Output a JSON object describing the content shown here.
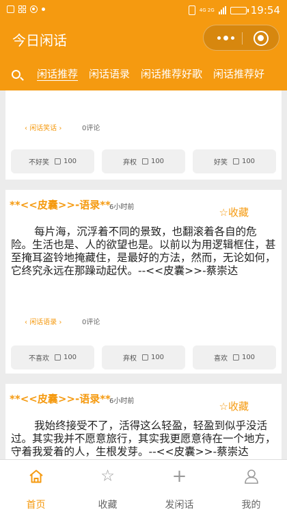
{
  "status_bar": {
    "network": "4G 2G",
    "time": "19:54"
  },
  "header": {
    "title": "今日闲话"
  },
  "tabs": [
    {
      "label": "闲话推荐",
      "active": true
    },
    {
      "label": "闲话语录",
      "active": false
    },
    {
      "label": "闲话推荐好歌",
      "active": false
    },
    {
      "label": "闲话推荐好",
      "active": false
    }
  ],
  "cards": [
    {
      "tag": "闲话笑话",
      "comments": "0评论",
      "buttons": [
        "不好笑 ",
        "弃权 ",
        "好笑 "
      ],
      "counts": [
        "100",
        "100",
        "100"
      ]
    },
    {
      "author": "**<<皮囊>>-语录**",
      "time": "6小时前",
      "fav": "☆收藏",
      "text": "每片海，沉浮着不同的景致，也翻滚着各自的危险。生活也是、人的欲望也是。以前以为用逻辑框住，甚至掩耳盗铃地掩藏住，是最好的方法，然而，无论如何，它终究永远在那躁动起伏。--<<皮囊>>-蔡崇达",
      "tag": "闲话语录",
      "comments": "0评论",
      "buttons": [
        "不喜欢 ",
        "弃权 ",
        "喜欢 "
      ],
      "counts": [
        "100",
        "100",
        "100"
      ]
    },
    {
      "author": "**<<皮囊>>-语录**",
      "time": "6小时前",
      "fav": "☆收藏",
      "text": "我始终接受不了，活得这么轻盈，轻盈到似乎没活过。其实我并不愿意旅行，其实我更愿意待在一个地方，守着我爱着的人，生根发芽。--<<皮囊>>-蔡崇达"
    }
  ],
  "bottom_nav": [
    {
      "label": "首页",
      "icon": "home-icon",
      "active": true
    },
    {
      "label": "收藏",
      "icon": "star-icon",
      "active": false
    },
    {
      "label": "发闲话",
      "icon": "plus-icon",
      "active": false
    },
    {
      "label": "我的",
      "icon": "user-icon",
      "active": false
    }
  ],
  "colors": {
    "accent": "#f59a10",
    "background": "#ececec"
  }
}
